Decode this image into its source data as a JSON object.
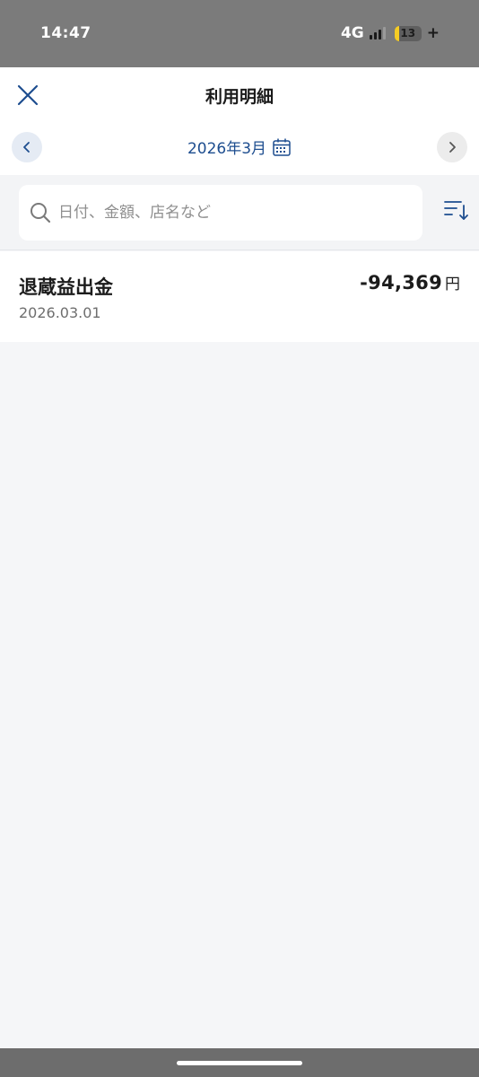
{
  "status_bar": {
    "time": "14:47",
    "network": "4G",
    "battery_level": "13",
    "battery_charging": "+"
  },
  "header": {
    "title": "利用明細",
    "close_icon": "close-icon",
    "month": "2026年3月",
    "prev_icon": "chevron-left-icon",
    "next_icon": "chevron-right-icon",
    "calendar_icon": "calendar-icon"
  },
  "search": {
    "placeholder": "日付、金額、店名など",
    "value": "",
    "search_icon": "search-icon",
    "sort_icon": "sort-icon"
  },
  "transactions": [
    {
      "title": "退蔵益出金",
      "date": "2026.03.01",
      "amount": "-94,369",
      "unit": "円"
    }
  ],
  "colors": {
    "accent": "#1d4d8f",
    "background": "#f5f6f8",
    "status_bar": "#7b7b7b",
    "battery": "#f5cc24"
  }
}
